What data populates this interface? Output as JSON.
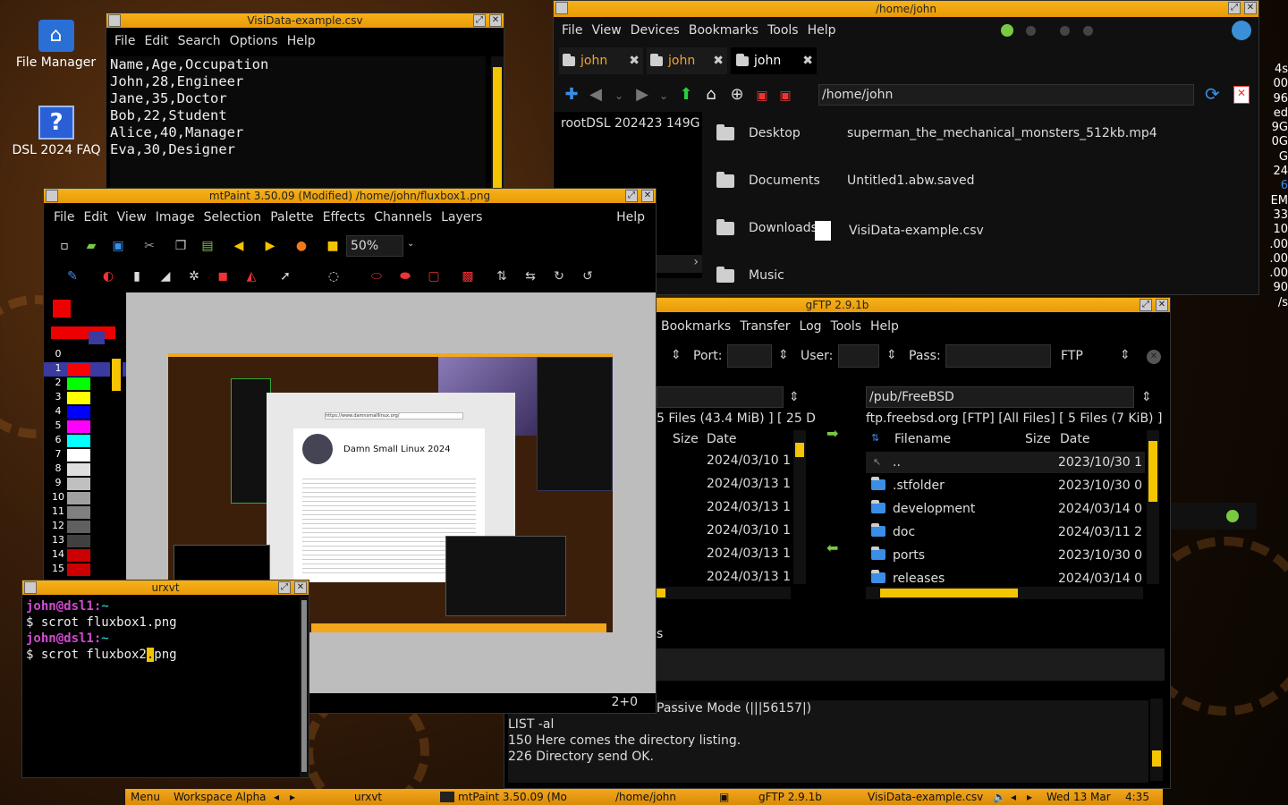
{
  "desktop": {
    "icons": [
      {
        "label": "File Manager"
      },
      {
        "label": "DSL 2024 FAQ"
      }
    ],
    "right_partial": [
      "4s",
      "00",
      "96",
      "ed",
      "9G",
      "0G",
      "G",
      "24",
      "6",
      "EM",
      "33",
      "10",
      ".00",
      ".00",
      ".00",
      "90",
      "/s"
    ]
  },
  "visidata": {
    "title": "VisiData-example.csv",
    "menu": [
      "File",
      "Edit",
      "Search",
      "Options",
      "Help"
    ],
    "lines": [
      "Name,Age,Occupation",
      "John,28,Engineer",
      "Jane,35,Doctor",
      "Bob,22,Student",
      "Alice,40,Manager",
      "Eva,30,Designer"
    ]
  },
  "filemgr": {
    "title": "/home/john",
    "menu": [
      "File",
      "View",
      "Devices",
      "Bookmarks",
      "Tools",
      "Help"
    ],
    "tabs": [
      "john",
      "john",
      "john"
    ],
    "path": "/home/john",
    "side": "rootDSL 202423 149G",
    "items": [
      {
        "name": "Desktop",
        "type": "folder"
      },
      {
        "name": "superman_the_mechanical_monsters_512kb.mp4",
        "type": "file"
      },
      {
        "name": "Documents",
        "type": "folder"
      },
      {
        "name": "Untitled1.abw.saved",
        "type": "file"
      },
      {
        "name": "Downloads",
        "type": "folder"
      },
      {
        "name": "VisiData-example.csv",
        "type": "file"
      },
      {
        "name": "Music",
        "type": "folder"
      }
    ]
  },
  "mtpaint": {
    "title": "mtPaint 3.50.09 (Modified) /home/john/fluxbox1.png",
    "menu": [
      "File",
      "Edit",
      "View",
      "Image",
      "Selection",
      "Palette",
      "Effects",
      "Channels",
      "Layers"
    ],
    "help": "Help",
    "zoom": "50%",
    "status": "2+0",
    "palette": [
      {
        "n": "0",
        "c": "#000000"
      },
      {
        "n": "1",
        "c": "#ff0000"
      },
      {
        "n": "2",
        "c": "#00ff00"
      },
      {
        "n": "3",
        "c": "#ffff00"
      },
      {
        "n": "4",
        "c": "#0000ff"
      },
      {
        "n": "5",
        "c": "#ff00ff"
      },
      {
        "n": "6",
        "c": "#00ffff"
      },
      {
        "n": "7",
        "c": "#ffffff"
      },
      {
        "n": "8",
        "c": "#e0e0e0"
      },
      {
        "n": "9",
        "c": "#c0c0c0"
      },
      {
        "n": "10",
        "c": "#a0a0a0"
      },
      {
        "n": "11",
        "c": "#808080"
      },
      {
        "n": "12",
        "c": "#606060"
      },
      {
        "n": "13",
        "c": "#404040"
      },
      {
        "n": "14",
        "c": "#cc0000"
      },
      {
        "n": "15",
        "c": "#cc0000"
      }
    ],
    "preview": {
      "heading": "Damn Small Linux 2024",
      "url": "https://www.damnsmalllinux.org/"
    }
  },
  "gftp": {
    "title": "gFTP 2.9.1b",
    "menu": [
      "Bookmarks",
      "Transfer",
      "Log",
      "Tools",
      "Help"
    ],
    "port_label": "Port:",
    "user_label": "User:",
    "pass_label": "Pass:",
    "protocol": "FTP",
    "remote_path": "/pub/FreeBSD",
    "left_summary": "5 Files (43.4 MiB) ] [ 25 D",
    "remote_summary": "ftp.freebsd.org [FTP] [All Files] [ 5 Files (7 KiB) ]",
    "cols": {
      "filename": "Filename",
      "size": "Size",
      "date": "Date"
    },
    "left_dates": [
      "2024/03/10 1",
      "2024/03/13 1",
      "2024/03/13 1",
      "2024/03/10 1",
      "2024/03/13 1",
      "2024/03/13 1"
    ],
    "remote_rows": [
      {
        "name": "..",
        "date": "2023/10/30 1"
      },
      {
        "name": ".stfolder",
        "date": "2023/10/30 0"
      },
      {
        "name": "development",
        "date": "2024/03/14 0"
      },
      {
        "name": "doc",
        "date": "2024/03/11 2"
      },
      {
        "name": "ports",
        "date": "2023/10/30 0"
      },
      {
        "name": "releases",
        "date": "2024/03/14 0"
      }
    ],
    "queue_frag": "s",
    "log": [
      "Passive Mode (|||56157|)",
      "LIST -al",
      "150 Here comes the directory listing.",
      "226 Directory send OK."
    ]
  },
  "urxvt": {
    "title": "urxvt",
    "user": "john@dsl1:",
    "tilde": "~",
    "cmd1": "$ scrot fluxbox1.png",
    "cmd2a": "$ scrot fluxbox2",
    "cursor": ".",
    "cmd2b": "png"
  },
  "taskbar": {
    "menu": "Menu",
    "workspace": "Workspace Alpha",
    "tasks": [
      "urxvt",
      "mtPaint 3.50.09 (Mo",
      "/home/john",
      "gFTP 2.9.1b",
      "VisiData-example.csv"
    ],
    "date": "Wed 13 Mar",
    "time": "4:35"
  }
}
